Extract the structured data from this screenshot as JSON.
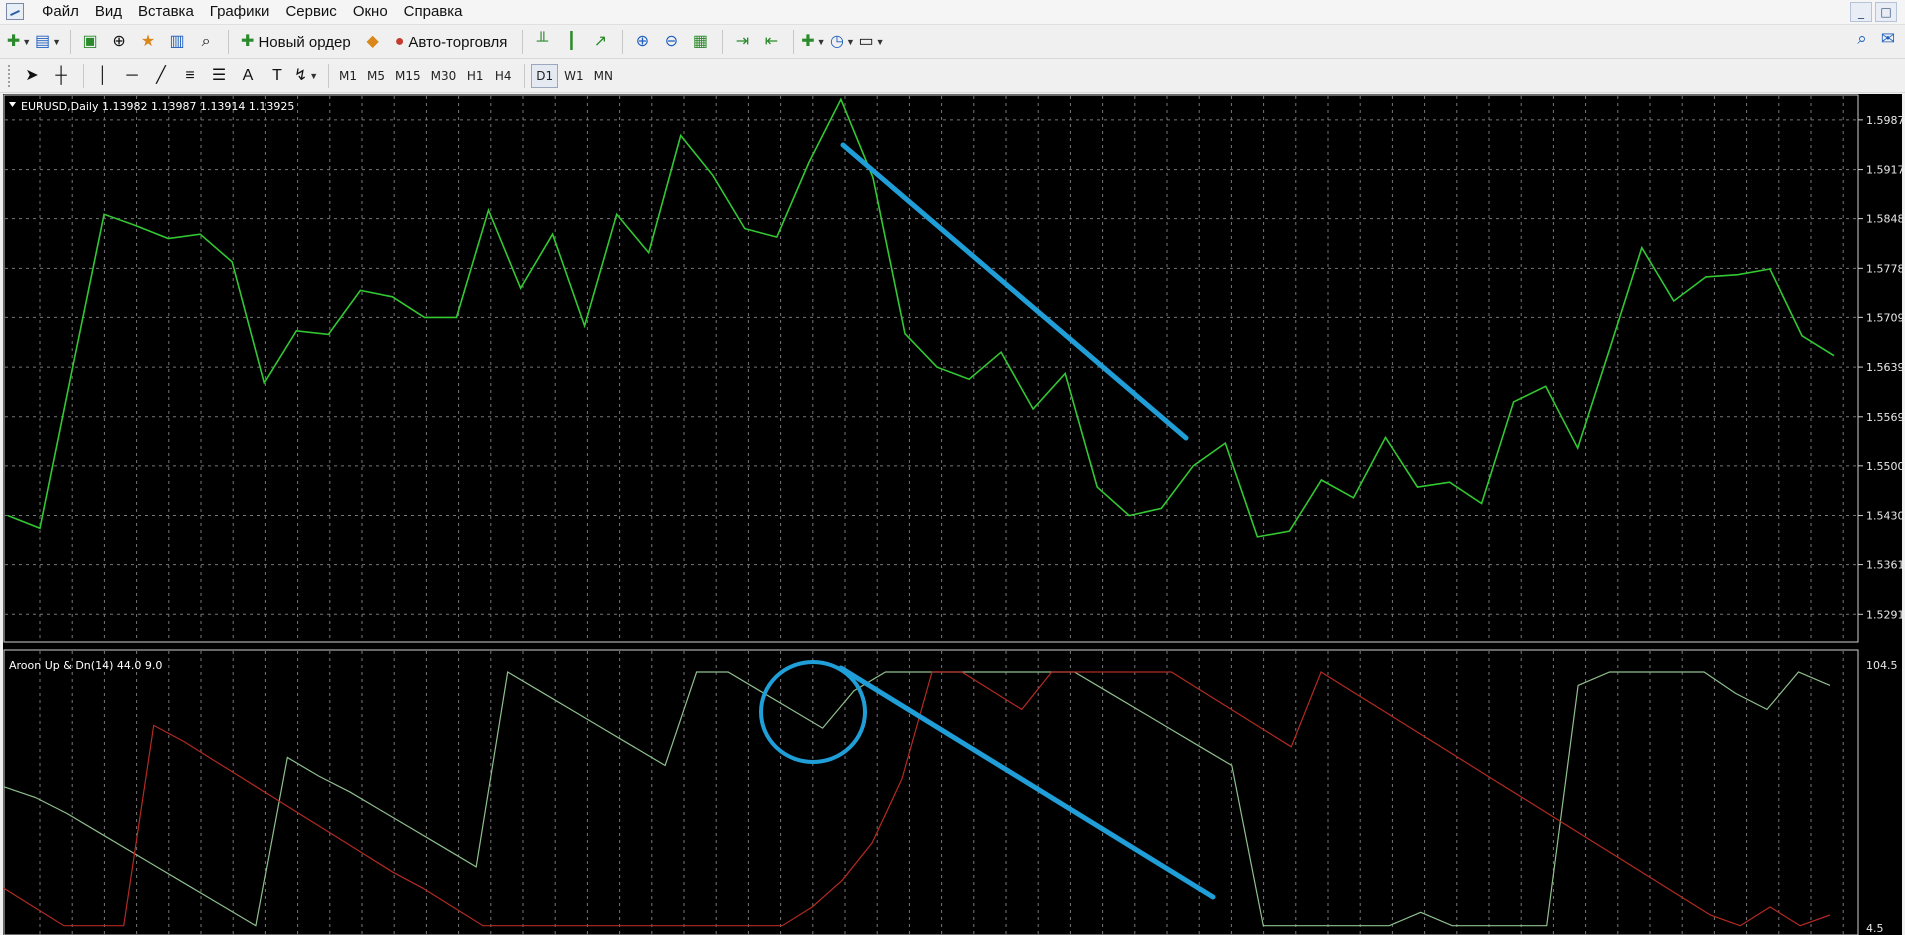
{
  "menu": [
    "Файл",
    "Вид",
    "Вставка",
    "Графики",
    "Сервис",
    "Окно",
    "Справка"
  ],
  "window_controls": [
    "_",
    "□"
  ],
  "toolbar1": {
    "new_order_label": "Новый ордер",
    "auto_trading_label": "Авто-торговля"
  },
  "timeframes": [
    "M1",
    "M5",
    "M15",
    "M30",
    "H1",
    "H4",
    "D1",
    "W1",
    "MN"
  ],
  "active_timeframe": "D1",
  "main_chart": {
    "header": "EURUSD,Daily  1.13982 1.13987 1.13914 1.13925",
    "price_ticks": [
      "1.5987",
      "1.5917",
      "1.5848",
      "1.5778",
      "1.5709",
      "1.5639",
      "1.5569",
      "1.5500",
      "1.5430",
      "1.5361",
      "1.5291"
    ],
    "line_color": "#32c832"
  },
  "indicator": {
    "header": "Aroon Up & Dn(14) 44.0 9.0",
    "scale_top": "104.5",
    "scale_bottom": "4.5",
    "up_color": "#8fbf8f",
    "down_color": "#b32a22"
  },
  "annotation_color": "#1f9ed8",
  "chart_data": [
    {
      "type": "line",
      "ylim": [
        1.5252,
        1.6022
      ],
      "series": [
        {
          "values": [
            1.543,
            1.5412,
            1.5635,
            1.5854,
            1.5838,
            1.582,
            1.5826,
            1.5787,
            1.5617,
            1.569,
            1.5685,
            1.5747,
            1.5738,
            1.5709,
            1.5709,
            1.586,
            1.575,
            1.5826,
            1.5697,
            1.5854,
            1.58,
            1.5965,
            1.5909,
            1.5834,
            1.5822,
            1.5927,
            1.6016,
            1.5906,
            1.5686,
            1.5639,
            1.5622,
            1.566,
            1.558,
            1.563,
            1.547,
            1.543,
            1.544,
            1.55,
            1.5532,
            1.54,
            1.5408,
            1.548,
            1.5455,
            1.554,
            1.547,
            1.5477,
            1.5447,
            1.559,
            1.5612,
            1.5525,
            1.5665,
            1.5807,
            1.5732,
            1.5766,
            1.5769,
            1.5777,
            1.5683,
            1.5655
          ]
        }
      ]
    },
    {
      "type": "line",
      "ylim": [
        4.5,
        104.5
      ],
      "series": [
        {
          "values": [
            57,
            53,
            47,
            40,
            33,
            26,
            19,
            12,
            5,
            68,
            61,
            55,
            48,
            41,
            34,
            27,
            100,
            93,
            86,
            79,
            72,
            65,
            100,
            100,
            93,
            86,
            79,
            93,
            100,
            100,
            100,
            100,
            100,
            100,
            100,
            93,
            86,
            79,
            72,
            65,
            5,
            5,
            5,
            5,
            5,
            10,
            5,
            5,
            5,
            5,
            95,
            100,
            100,
            100,
            100,
            92,
            86,
            100,
            95
          ]
        },
        {
          "values": [
            19,
            12,
            5,
            5,
            5,
            80,
            74,
            67,
            60,
            53,
            46,
            39,
            32,
            25,
            19,
            12,
            5,
            5,
            5,
            5,
            5,
            5,
            5,
            5,
            5,
            5,
            5,
            12,
            22,
            36,
            60,
            100,
            100,
            93,
            86,
            100,
            100,
            100,
            100,
            100,
            93,
            86,
            79,
            72,
            100,
            93,
            86,
            79,
            72,
            65,
            58,
            51,
            44,
            37,
            30,
            23,
            16,
            9,
            5,
            12,
            5,
            9
          ]
        }
      ]
    }
  ]
}
